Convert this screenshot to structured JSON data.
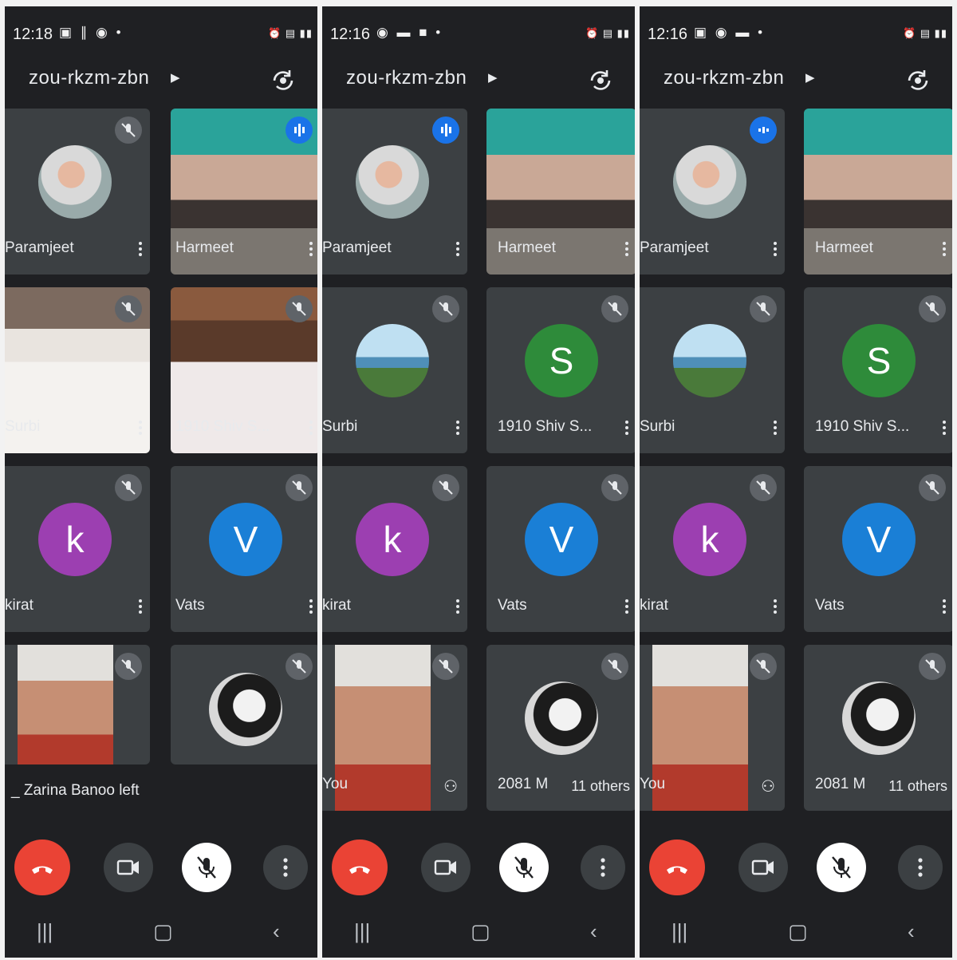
{
  "screens": [
    {
      "time": "12:18",
      "meeting_code": "zou-rkzm-zbn",
      "tiles": [
        "Paramjeet",
        "Harmeet",
        "Surbi",
        "1910 Shiv S...",
        "kirat",
        "Vats"
      ],
      "left_notice": "_ Zarina Banoo left"
    },
    {
      "time": "12:16",
      "meeting_code": "zou-rkzm-zbn",
      "tiles": [
        "Paramjeet",
        "Harmeet",
        "Surbi",
        "1910 Shiv S...",
        "kirat",
        "Vats"
      ],
      "self_label": "You",
      "bottom_right_name": "2081 M",
      "others": "11 others"
    },
    {
      "time": "12:16",
      "meeting_code": "zou-rkzm-zbn",
      "tiles": [
        "Paramjeet",
        "Harmeet",
        "Surbi",
        "1910 Shiv S...",
        "kirat",
        "Vats"
      ],
      "self_label": "You",
      "bottom_right_name": "2081 M",
      "others": "11 others"
    }
  ],
  "avatar_letters": {
    "shiv": "S",
    "kirat": "k",
    "vats": "V"
  },
  "colors": {
    "screen_bg": "#1f2023",
    "tile_bg": "#3c4043",
    "end_call": "#ea4335",
    "avatar_s": "#2e8b3a",
    "avatar_k": "#9c3fb1",
    "avatar_v": "#1a7fd6",
    "speaking": "#1a73e8"
  }
}
